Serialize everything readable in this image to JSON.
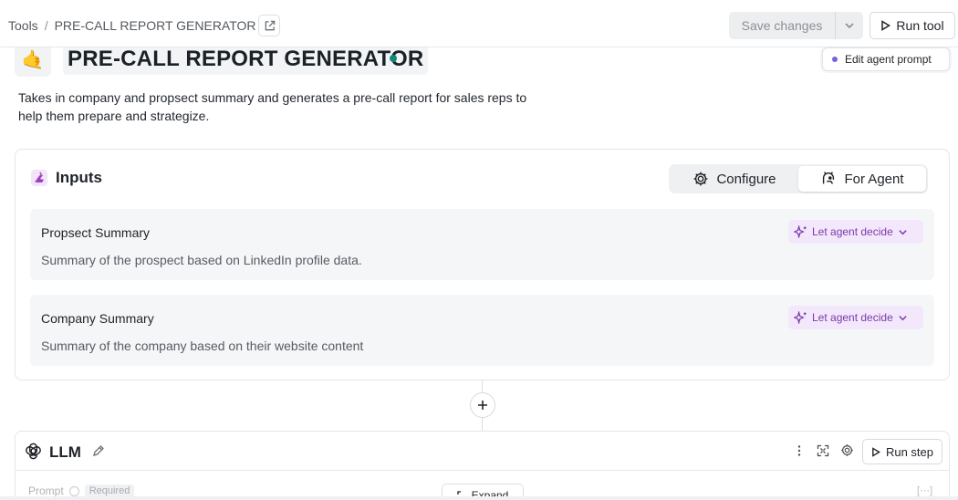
{
  "topbar": {
    "breadcrumb_root": "Tools",
    "breadcrumb_sep": "/",
    "breadcrumb_current": "PRE-CALL REPORT GENERATOR",
    "save_label": "Save changes",
    "run_label": "Run tool"
  },
  "header": {
    "emoji": "🤙",
    "title": "PRE-CALL REPORT GENERATOR",
    "edit_prompt_label": "Edit agent prompt",
    "description": "Takes in company and propsect summary and generates a pre-call report for sales reps to help them prepare and strategize."
  },
  "inputs": {
    "title": "Inputs",
    "segments": [
      {
        "label": "Configure",
        "icon": "gear-icon",
        "active": false
      },
      {
        "label": "For Agent",
        "icon": "agent-icon",
        "active": true
      }
    ],
    "fields": [
      {
        "label": "Propsect Summary",
        "description": "Summary of the prospect based on LinkedIn profile data.",
        "mode": "Let agent decide"
      },
      {
        "label": "Company Summary",
        "description": "Summary of the company based on their website content",
        "mode": "Let agent decide"
      }
    ]
  },
  "llm": {
    "title": "LLM",
    "run_label": "Run step",
    "prompt_label": "Prompt",
    "required_badge": "Required",
    "expand_label": "Expand"
  },
  "colors": {
    "accent_purple": "#7c3aa9",
    "pill_bg": "#f3e8fb",
    "cursor_dot": "#0f8a78"
  }
}
